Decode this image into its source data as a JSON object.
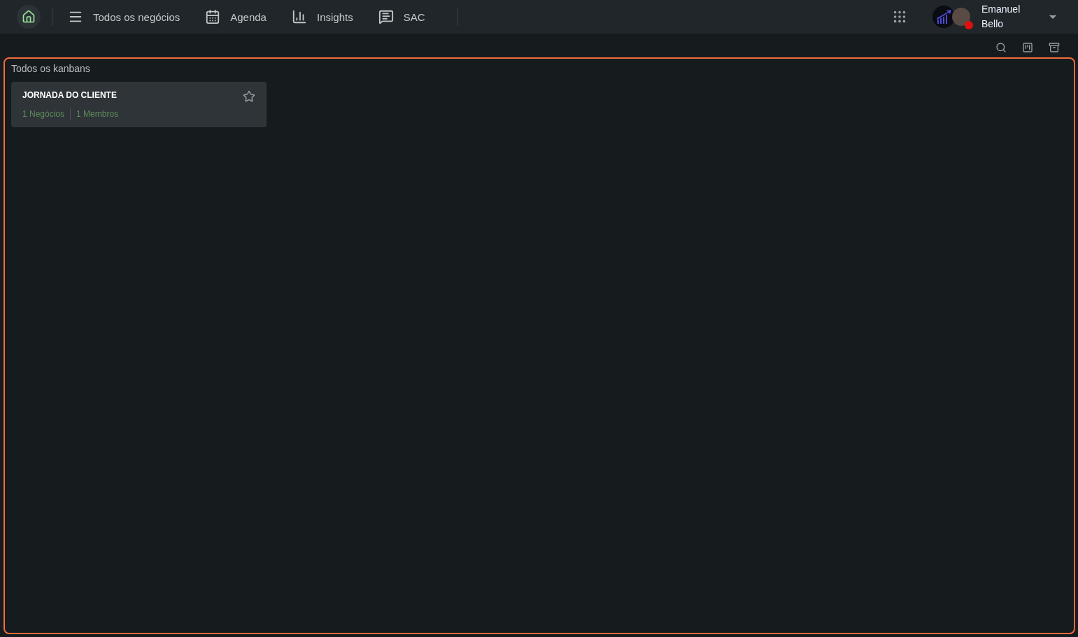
{
  "nav": {
    "home": {
      "selected": true
    },
    "items": [
      {
        "kind": "list",
        "label": "Todos os negócios"
      },
      {
        "kind": "calendar",
        "label": "Agenda"
      },
      {
        "kind": "chart",
        "label": "Insights"
      },
      {
        "kind": "chat",
        "label": "SAC"
      }
    ]
  },
  "user": {
    "first_name": "Emanuel",
    "last_name": "Bello",
    "status": {
      "color": "#e01010"
    }
  },
  "section": {
    "title": "Todos os kanbans",
    "boards": [
      {
        "name": "JORNADA DO CLIENTE",
        "deals": "1 Negócios",
        "members": "1 Membros",
        "favorite": false
      }
    ]
  }
}
